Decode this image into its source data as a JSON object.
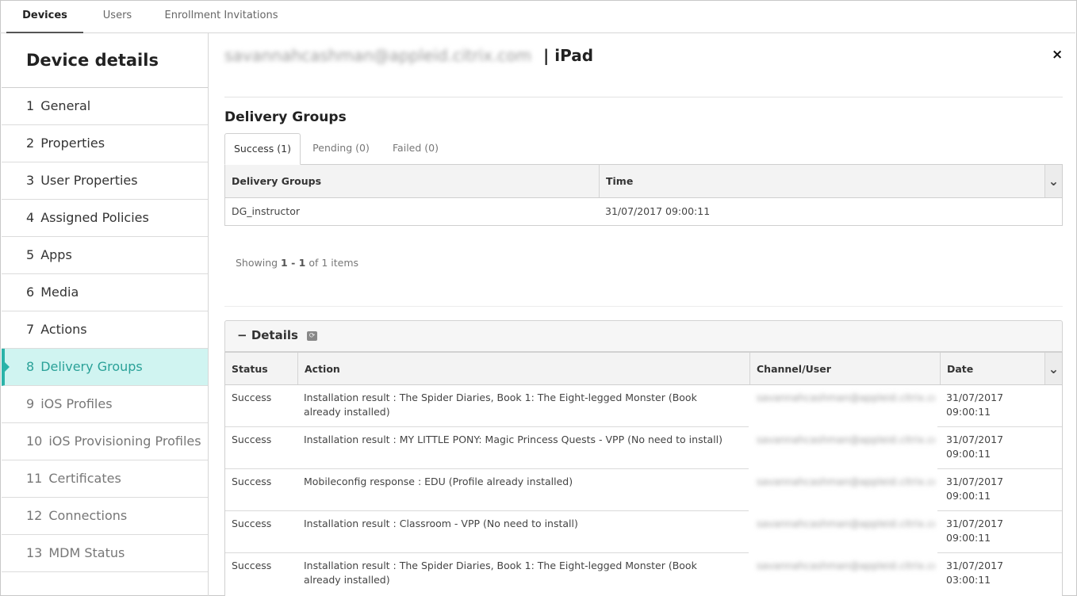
{
  "top_tabs": [
    {
      "label": "Devices",
      "active": true
    },
    {
      "label": "Users",
      "active": false
    },
    {
      "label": "Enrollment Invitations",
      "active": false
    }
  ],
  "sidebar": {
    "title": "Device details",
    "items": [
      {
        "num": "1",
        "label": "General"
      },
      {
        "num": "2",
        "label": "Properties"
      },
      {
        "num": "3",
        "label": "User Properties"
      },
      {
        "num": "4",
        "label": "Assigned Policies"
      },
      {
        "num": "5",
        "label": "Apps"
      },
      {
        "num": "6",
        "label": "Media"
      },
      {
        "num": "7",
        "label": "Actions"
      },
      {
        "num": "8",
        "label": "Delivery Groups"
      },
      {
        "num": "9",
        "label": "iOS Profiles"
      },
      {
        "num": "10",
        "label": "iOS Provisioning Profiles"
      },
      {
        "num": "11",
        "label": "Certificates"
      },
      {
        "num": "12",
        "label": "Connections"
      },
      {
        "num": "13",
        "label": "MDM Status"
      }
    ]
  },
  "header": {
    "email_blurred": "savannahcashman@appleid.citrix.com",
    "separator": "|",
    "device": "iPad",
    "close_glyph": "×"
  },
  "delivery_groups": {
    "title": "Delivery Groups",
    "tabs": [
      "Success (1)",
      "Pending (0)",
      "Failed (0)"
    ],
    "columns": [
      "Delivery Groups",
      "Time"
    ],
    "rows": [
      {
        "group": "DG_instructor",
        "time": "31/07/2017 09:00:11"
      }
    ],
    "showing_prefix": "Showing",
    "showing_range": "1 - 1",
    "showing_suffix": "of 1 items"
  },
  "details": {
    "toggle": "−",
    "title": "Details",
    "columns": [
      "Status",
      "Action",
      "Channel/User",
      "Date"
    ],
    "rows": [
      {
        "status": "Success",
        "action": "Installation result : The Spider Diaries, Book 1: The Eight-legged Monster (Book already installed)",
        "channel": "savannahcashman@appleid.citrix.com",
        "date": "31/07/2017 09:00:11"
      },
      {
        "status": "Success",
        "action": "Installation result : MY LITTLE PONY: Magic Princess Quests - VPP (No need to install)",
        "channel": "savannahcashman@appleid.citrix.com",
        "date": "31/07/2017 09:00:11"
      },
      {
        "status": "Success",
        "action": "Mobileconfig response : EDU (Profile already installed)",
        "channel": "savannahcashman@appleid.citrix.com",
        "date": "31/07/2017 09:00:11"
      },
      {
        "status": "Success",
        "action": "Installation result : Classroom - VPP (No need to install)",
        "channel": "savannahcashman@appleid.citrix.com",
        "date": "31/07/2017 09:00:11"
      },
      {
        "status": "Success",
        "action": "Installation result : The Spider Diaries, Book 1: The Eight-legged Monster (Book already installed)",
        "channel": "savannahcashman@appleid.citrix.com",
        "date": "31/07/2017 03:00:11"
      }
    ]
  },
  "colors": {
    "accent": "#2bb3a9",
    "active_bg": "#d0f4f1"
  }
}
